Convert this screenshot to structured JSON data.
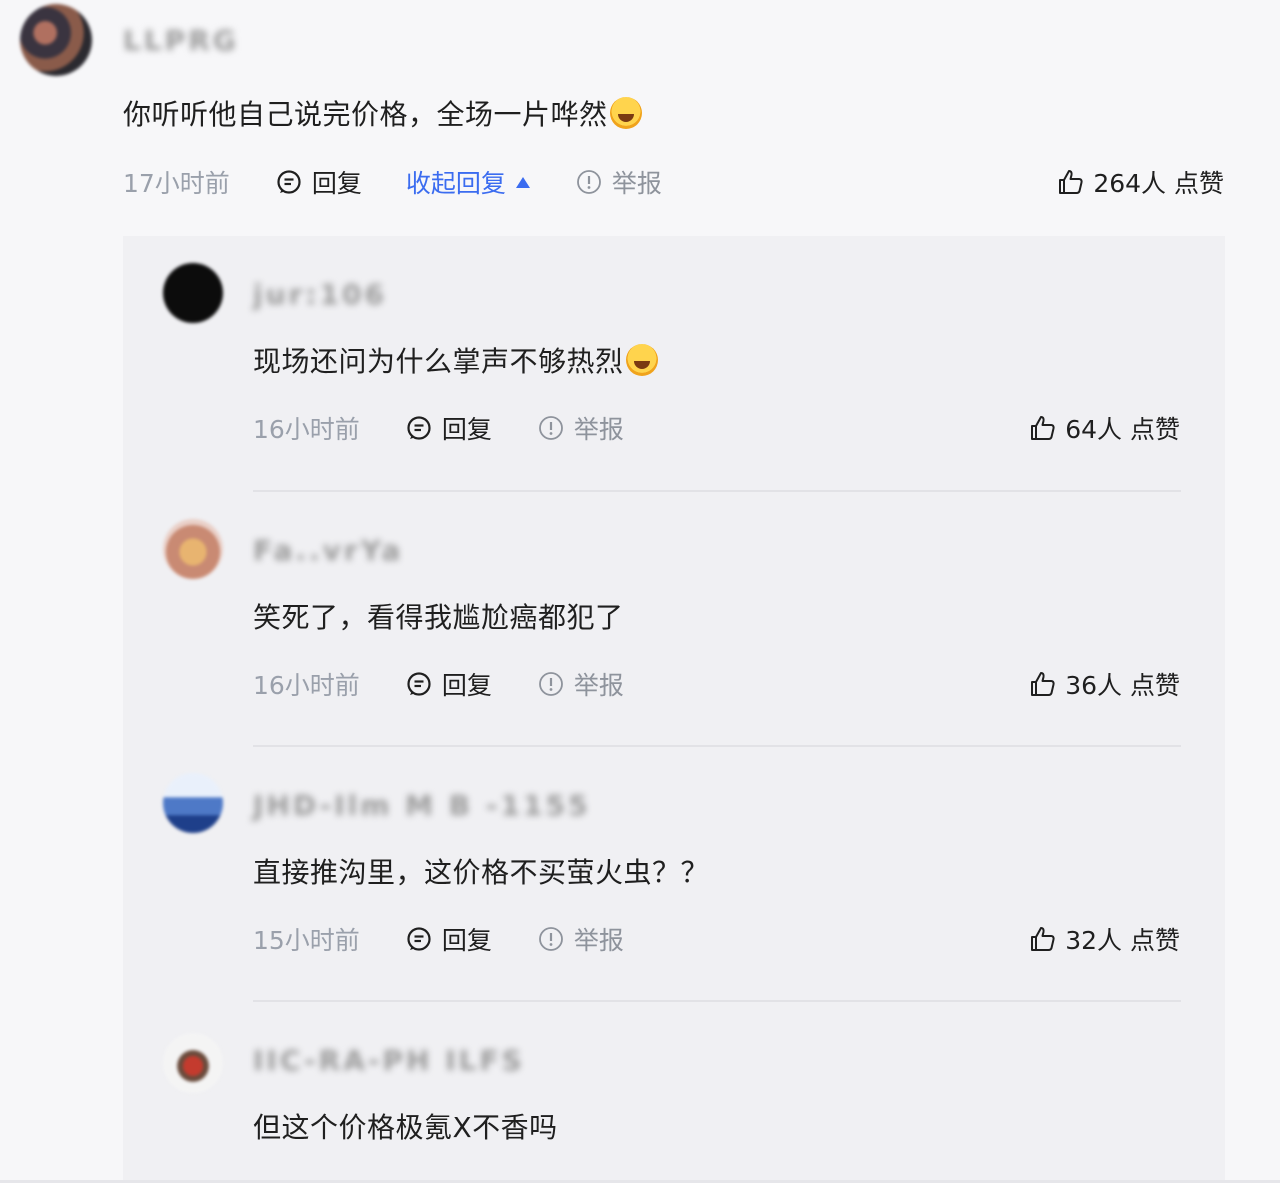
{
  "comment": {
    "username": "LLPRG",
    "content": "你听听他自己说完价格，全场一片哗然",
    "time": "17小时前",
    "reply_label": "回复",
    "collapse_label": "收起回复",
    "report_label": "举报",
    "likes": "264人 点赞"
  },
  "replies": [
    {
      "username": "jur:106",
      "content": "现场还问为什么掌声不够热烈",
      "time": "16小时前",
      "reply_label": "回复",
      "report_label": "举报",
      "likes": "64人 点赞"
    },
    {
      "username": "Fa..vrYa",
      "content": "笑死了，看得我尴尬癌都犯了",
      "time": "16小时前",
      "reply_label": "回复",
      "report_label": "举报",
      "likes": "36人 点赞"
    },
    {
      "username": "JHD-Ilm M B -1155",
      "content": "直接推沟里，这价格不买萤火虫？？",
      "time": "15小时前",
      "reply_label": "回复",
      "report_label": "举报",
      "likes": "32人 点赞"
    },
    {
      "username": "IIC-RA-PH ILFS",
      "content": "但这个价格极氪X不香吗"
    }
  ],
  "colors": {
    "accent": "#3b6cf0",
    "muted": "#9aa0ab",
    "reply_bg": "#f0f0f3",
    "page_bg": "#f7f7f9"
  }
}
